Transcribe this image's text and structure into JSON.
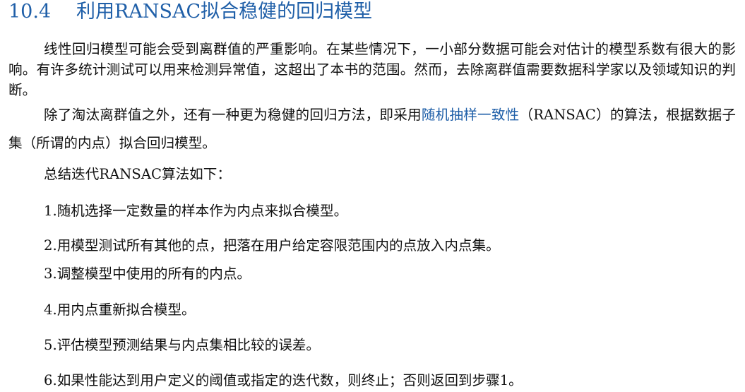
{
  "section": {
    "number": "10.4",
    "title": "利用RANSAC拟合稳健的回归模型"
  },
  "paragraphs": {
    "p1": "线性回归模型可能会受到离群值的严重影响。在某些情况下，一小部分数据可能会对估计的模型系数有很大的影响。有许多统计测试可以用来检测异常值，这超出了本书的范围。然而，去除离群值需要数据科学家以及领域知识的判断。",
    "p2_before": "除了淘汰离群值之外，还有一种更为稳健的回归方法，即采用",
    "p2_link": "随机抽样一致性",
    "p2_after": "（RANSAC）的算法，根据数据子集（所谓的内点）拟合回归模型。",
    "summary": "总结迭代RANSAC算法如下："
  },
  "steps": [
    "1.随机选择一定数量的样本作为内点来拟合模型。",
    "2.用模型测试所有其他的点，把落在用户给定容限范围内的点放入内点集。",
    "3.调整模型中使用的所有的内点。",
    "4.用内点重新拟合模型。",
    "5.评估模型预测结果与内点集相比较的误差。",
    "6.如果性能达到用户定义的阈值或指定的迭代数，则终止；否则返回到步骤1。"
  ],
  "colors": {
    "heading": "#1f5fa8",
    "link": "#1f5fa8",
    "text": "#111111"
  }
}
